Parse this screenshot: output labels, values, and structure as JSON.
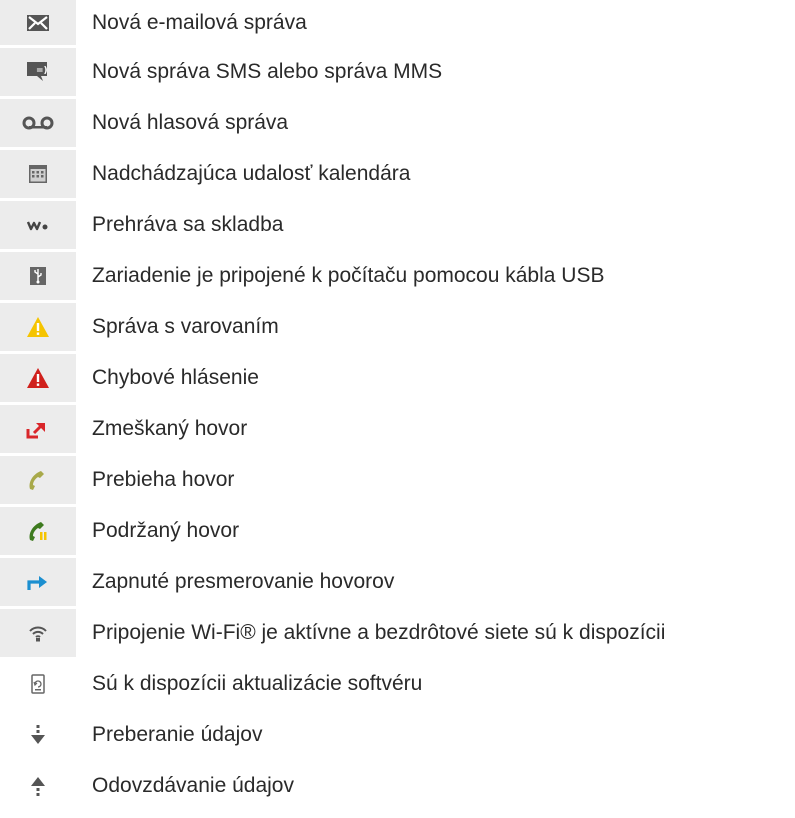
{
  "rows": [
    {
      "icon": "envelope-icon",
      "text": "Nová e-mailová správa"
    },
    {
      "icon": "sms-message-icon",
      "text": "Nová správa SMS alebo správa MMS"
    },
    {
      "icon": "voicemail-icon",
      "text": "Nová hlasová správa"
    },
    {
      "icon": "calendar-icon",
      "text": "Nadchádzajúca udalosť kalendára"
    },
    {
      "icon": "walkman-icon",
      "text": "Prehráva sa skladba"
    },
    {
      "icon": "usb-icon",
      "text": "Zariadenie je pripojené k počítaču pomocou kábla USB"
    },
    {
      "icon": "warning-icon",
      "text": "Správa s varovaním"
    },
    {
      "icon": "error-icon",
      "text": "Chybové hlásenie"
    },
    {
      "icon": "missed-call-icon",
      "text": "Zmeškaný hovor"
    },
    {
      "icon": "call-in-progress-icon",
      "text": "Prebieha hovor"
    },
    {
      "icon": "call-on-hold-icon",
      "text": "Podržaný hovor"
    },
    {
      "icon": "call-forwarding-icon",
      "text": "Zapnuté presmerovanie hovorov"
    },
    {
      "icon": "wifi-icon",
      "text": "Pripojenie Wi-Fi® je aktívne a bezdrôtové siete sú k dispozícii"
    },
    {
      "icon": "software-update-icon",
      "text": "Sú k dispozícii aktualizácie softvéru"
    },
    {
      "icon": "download-icon",
      "text": "Preberanie údajov"
    },
    {
      "icon": "upload-icon",
      "text": "Odovzdávanie údajov"
    }
  ],
  "colors": {
    "icon_cell_bg": "#ececec",
    "warning_yellow": "#f5c400",
    "error_red": "#d0201c",
    "missed_call_red": "#d9262a",
    "call_green": "#3d7a1e",
    "forward_blue": "#1b8fd0"
  }
}
